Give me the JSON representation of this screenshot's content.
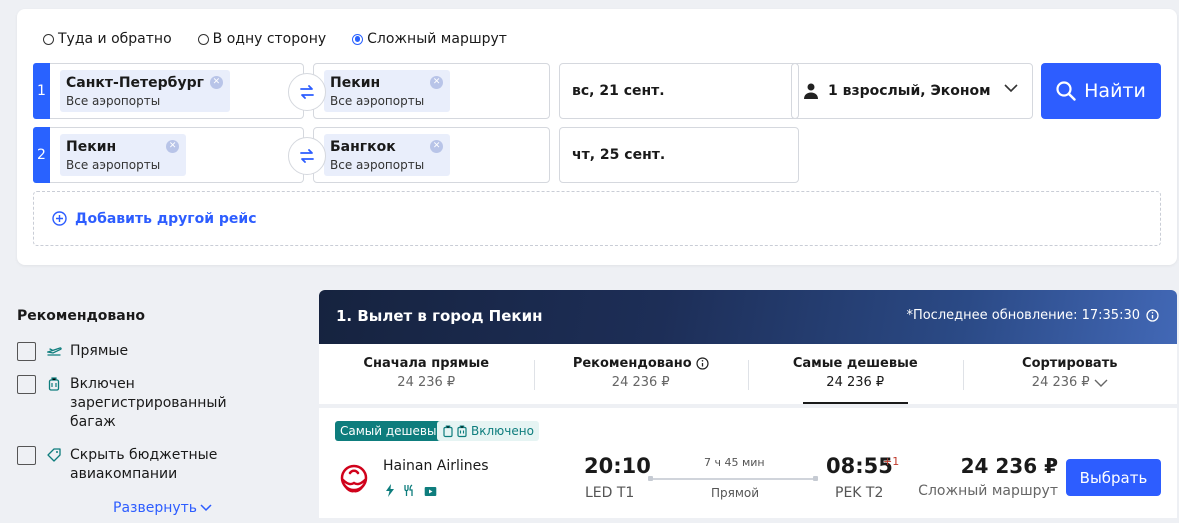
{
  "trip_types": [
    {
      "label": "Туда и обратно",
      "checked": false
    },
    {
      "label": "В одну сторону",
      "checked": false
    },
    {
      "label": "Сложный маршрут",
      "checked": true
    }
  ],
  "legs": [
    {
      "num": "1",
      "from_city": "Санкт-Петербург",
      "from_airports": "Все аэропорты",
      "to_city": "Пекин",
      "to_airports": "Все аэропорты",
      "date": "вс, 21 сент."
    },
    {
      "num": "2",
      "from_city": "Пекин",
      "from_airports": "Все аэропорты",
      "to_city": "Бангкок",
      "to_airports": "Все аэропорты",
      "date": "чт, 25 сент."
    }
  ],
  "passengers": "1 взрослый, Эконом",
  "search_label": "Найти",
  "add_leg_label": "Добавить другой рейс",
  "filters": {
    "title": "Рекомендовано",
    "items": [
      {
        "label": "Прямые",
        "icon": "plane-icon"
      },
      {
        "label": "Включен зарегистрированный багаж",
        "icon": "luggage-icon"
      },
      {
        "label": "Скрыть бюджетные авиакомпании",
        "icon": "tag-icon"
      }
    ],
    "expand_label": "Развернуть"
  },
  "results": {
    "title": "1. Вылет в город Пекин",
    "updated": "*Последнее обновление: 17:35:30",
    "sort_tabs": [
      {
        "label": "Сначала прямые",
        "value": "24 236 ₽"
      },
      {
        "label": "Рекомендовано",
        "value": "24 236 ₽"
      },
      {
        "label": "Самые дешевые",
        "value": "24 236 ₽"
      },
      {
        "label": "Сортировать",
        "value": "24 236 ₽"
      }
    ]
  },
  "ticket": {
    "badge_cheapest": "Самый дешевый",
    "badge_baggage": "Включено",
    "airline": "Hainan Airlines",
    "dep_time": "20:10",
    "dep_airport": "LED T1",
    "duration": "7 ч 45 мин",
    "stops": "Прямой",
    "arr_time": "08:55",
    "plus_day": "+1",
    "arr_airport": "PEK T2",
    "price": "24 236 ₽",
    "price_note": "Сложный маршрут",
    "select_label": "Выбрать"
  },
  "colors": {
    "accent": "#2d5dff",
    "teal": "#0e7d7d"
  }
}
